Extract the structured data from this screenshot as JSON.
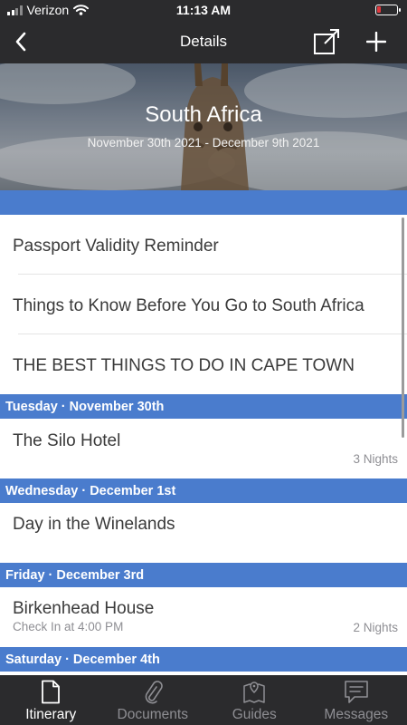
{
  "status_bar": {
    "carrier": "Verizon",
    "time": "11:13 AM",
    "battery_level": 0.15
  },
  "nav": {
    "title": "Details"
  },
  "hero": {
    "title": "South Africa",
    "dates": "November 30th 2021 - December 9th 2021"
  },
  "guides": [
    {
      "label": "Passport Validity Reminder"
    },
    {
      "label": "Things to Know Before You Go to South Africa"
    },
    {
      "label": "THE BEST THINGS TO DO IN CAPE TOWN"
    }
  ],
  "days": [
    {
      "header": "Tuesday · November 30th",
      "item": {
        "title": "The Silo Hotel",
        "subtitle": "",
        "meta": "3 Nights"
      }
    },
    {
      "header": "Wednesday · December 1st",
      "item": {
        "title": "Day in the Winelands",
        "subtitle": "",
        "meta": ""
      }
    },
    {
      "header": "Friday · December 3rd",
      "item": {
        "title": "Birkenhead House",
        "subtitle": "Check In at 4:00 PM",
        "meta": "2 Nights"
      }
    },
    {
      "header": "Saturday · December 4th"
    }
  ],
  "tabs": [
    {
      "label": "Itinerary",
      "icon": "document-icon",
      "active": true
    },
    {
      "label": "Documents",
      "icon": "paperclip-icon",
      "active": false
    },
    {
      "label": "Guides",
      "icon": "map-pin-icon",
      "active": false
    },
    {
      "label": "Messages",
      "icon": "chat-bubble-icon",
      "active": false
    }
  ],
  "colors": {
    "bar": "#2b2b2d",
    "accent": "#4a7ccd",
    "muted": "#8e8e93",
    "battery_low": "#e0383e"
  }
}
